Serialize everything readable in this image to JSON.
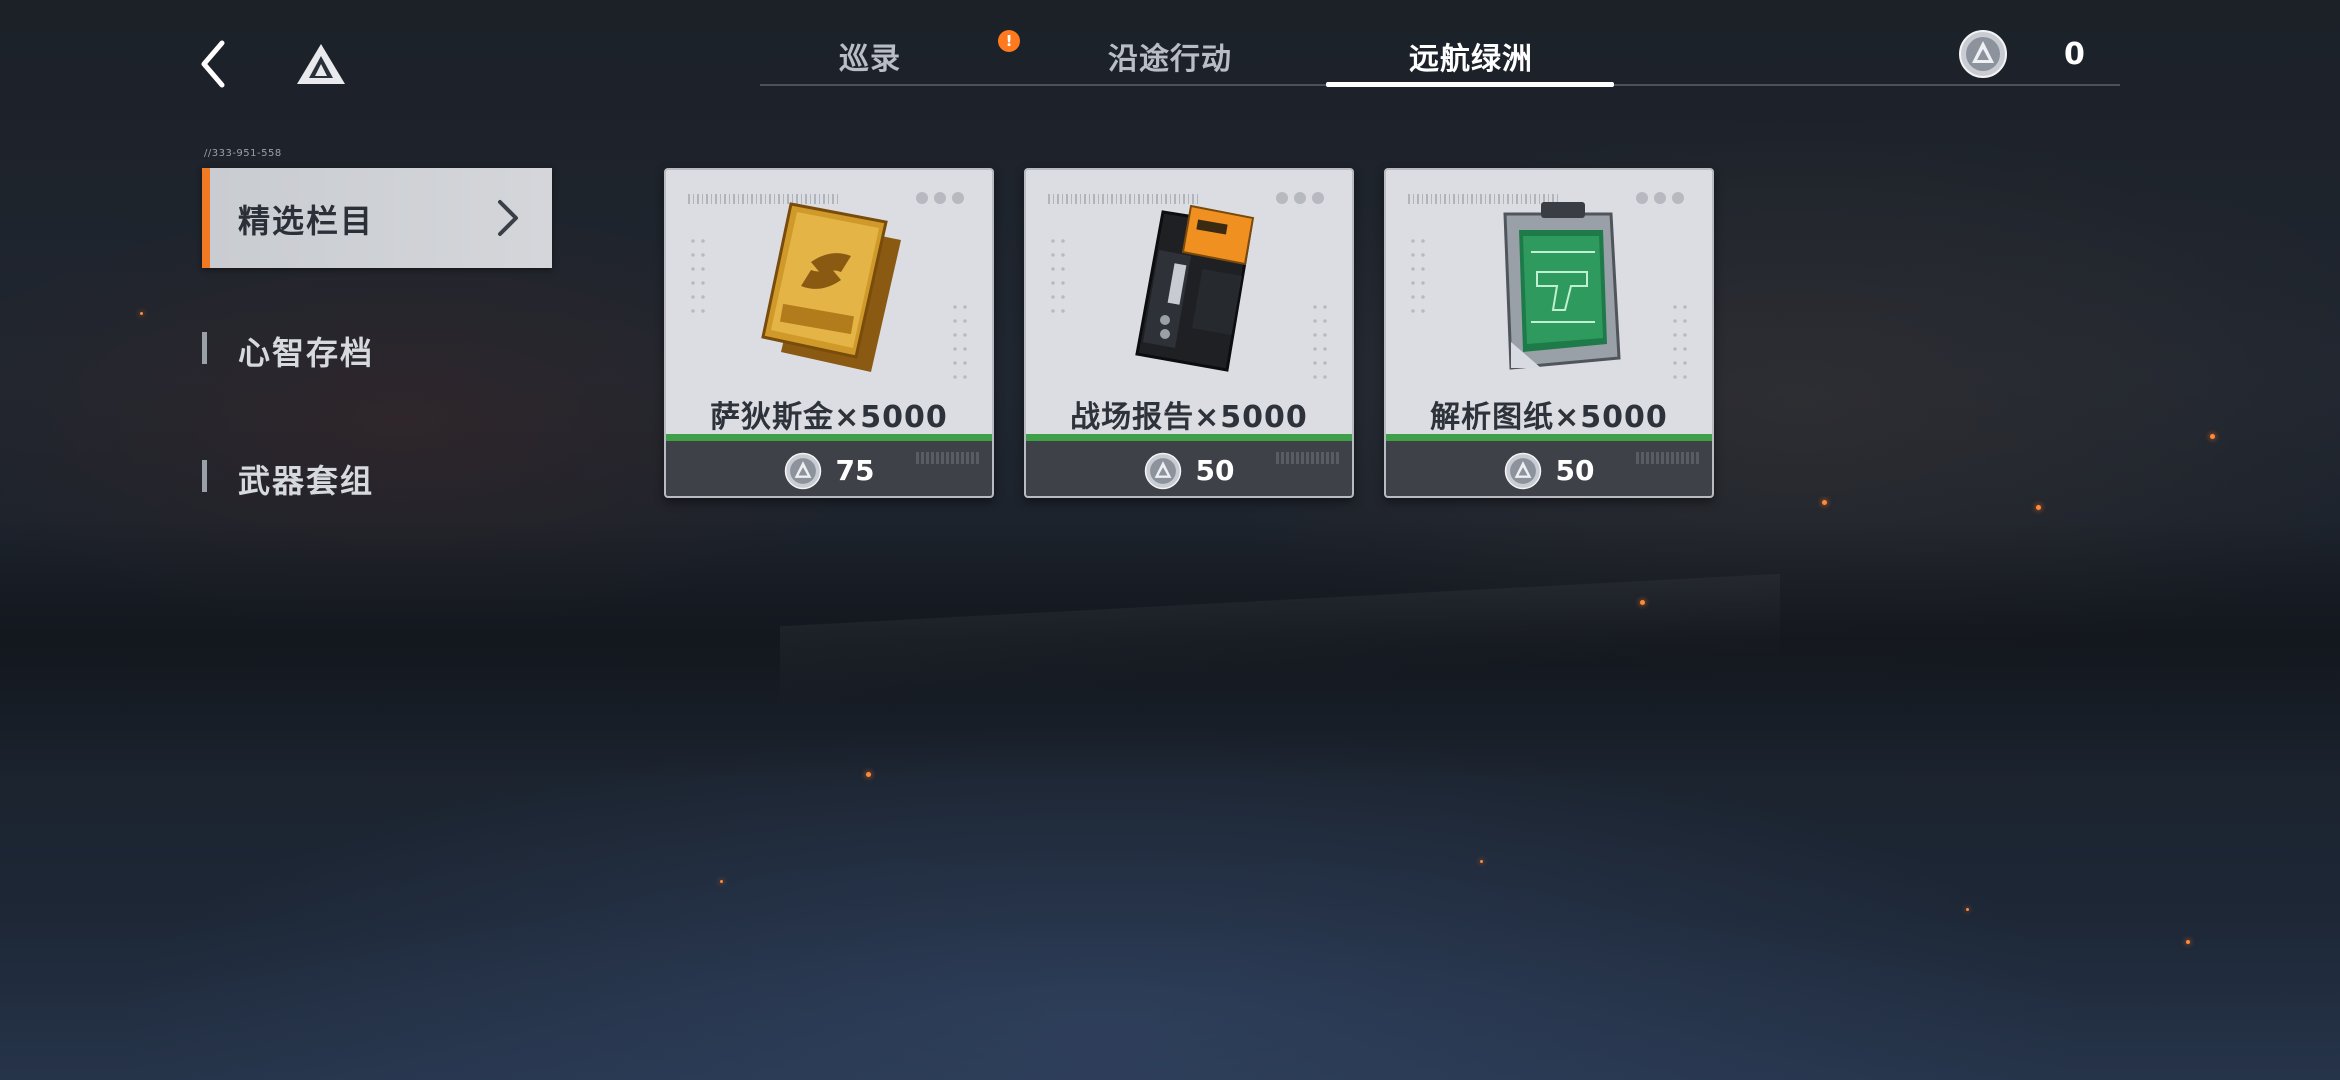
{
  "header": {
    "back_icon": "back-arrow-icon",
    "logo_icon": "triangle-logo-icon",
    "tabs": [
      {
        "label": "巡录",
        "active": false,
        "alert": "!"
      },
      {
        "label": "沿途行动",
        "active": false
      },
      {
        "label": "远航绿洲",
        "active": true
      }
    ],
    "currency": {
      "icon": "silver-coin-icon",
      "amount": "0"
    }
  },
  "sidebar": {
    "code": "//333-951-558",
    "items": [
      {
        "label": "精选栏目",
        "active": true
      },
      {
        "label": "心智存档",
        "active": false
      },
      {
        "label": "武器套组",
        "active": false
      }
    ]
  },
  "shop": {
    "items": [
      {
        "name": "萨狄斯金×5000",
        "price": "75",
        "icon": "gold-bar-icon"
      },
      {
        "name": "战场报告×5000",
        "price": "50",
        "icon": "report-device-icon"
      },
      {
        "name": "解析图纸×5000",
        "price": "50",
        "icon": "blueprint-case-icon"
      }
    ]
  },
  "colors": {
    "accent": "#f07a24",
    "price_strip": "#3fa049",
    "card_bg": "#dcdde2",
    "price_bar_bg": "#3e4248"
  }
}
